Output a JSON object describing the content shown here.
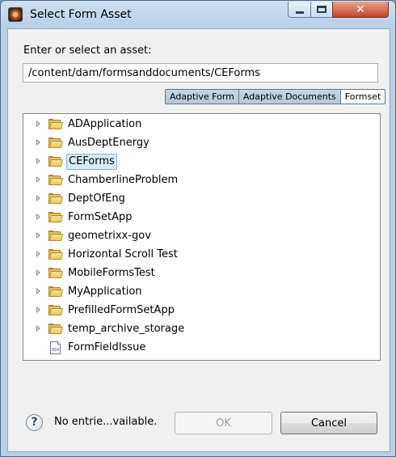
{
  "window": {
    "title": "Select Form Asset",
    "controls": {
      "minimize": "minimize-icon",
      "maximize": "maximize-icon",
      "close": "✕"
    }
  },
  "prompt": "Enter or select an asset:",
  "path_value": "/content/dam/formsanddocuments/CEForms",
  "filter_tabs": [
    {
      "label": "Adaptive Form",
      "pressed": true
    },
    {
      "label": "Adaptive Documents",
      "pressed": true
    },
    {
      "label": "Formset",
      "pressed": false
    }
  ],
  "tree": {
    "items": [
      {
        "label": "ADApplication",
        "type": "folder",
        "selected": false
      },
      {
        "label": "AusDeptEnergy",
        "type": "folder",
        "selected": false
      },
      {
        "label": "CEForms",
        "type": "folder",
        "selected": true
      },
      {
        "label": "ChamberlineProblem",
        "type": "folder",
        "selected": false
      },
      {
        "label": "DeptOfEng",
        "type": "folder",
        "selected": false
      },
      {
        "label": "FormSetApp",
        "type": "folder",
        "selected": false
      },
      {
        "label": "geometrixx-gov",
        "type": "folder",
        "selected": false
      },
      {
        "label": "Horizontal Scroll Test",
        "type": "folder",
        "selected": false
      },
      {
        "label": "MobileFormsTest",
        "type": "folder",
        "selected": false
      },
      {
        "label": "MyApplication",
        "type": "folder",
        "selected": false
      },
      {
        "label": "PrefilledFormSetApp",
        "type": "folder",
        "selected": false
      },
      {
        "label": "temp_archive_storage",
        "type": "folder",
        "selected": false
      },
      {
        "label": "FormFieldIssue",
        "type": "file",
        "selected": false,
        "file_tag": "010"
      }
    ]
  },
  "footer": {
    "help_glyph": "?",
    "status": "No entrie...vailable.",
    "ok_label": "OK",
    "ok_enabled": false,
    "cancel_label": "Cancel"
  }
}
